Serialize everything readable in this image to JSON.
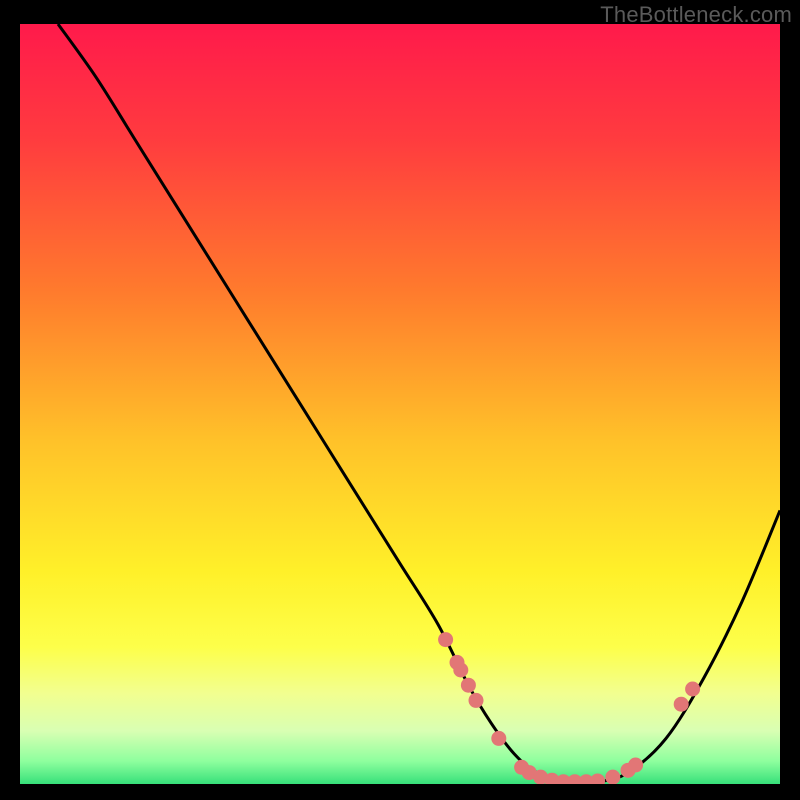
{
  "watermark": "TheBottleneck.com",
  "chart_data": {
    "type": "line",
    "title": "",
    "xlabel": "",
    "ylabel": "",
    "xlim": [
      0,
      100
    ],
    "ylim": [
      0,
      100
    ],
    "series": [
      {
        "name": "bottleneck-curve",
        "x": [
          5,
          10,
          15,
          20,
          25,
          30,
          35,
          40,
          45,
          50,
          55,
          59,
          62,
          65,
          68,
          72,
          76,
          80,
          85,
          90,
          95,
          100
        ],
        "y": [
          100,
          93,
          85,
          77,
          69,
          61,
          53,
          45,
          37,
          29,
          21,
          13,
          8,
          4,
          1.5,
          0.3,
          0.3,
          1.5,
          6,
          14,
          24,
          36
        ]
      }
    ],
    "markers": {
      "name": "highlighted-points",
      "color": "#e27676",
      "x": [
        56,
        57.5,
        58,
        59,
        60,
        63,
        66,
        67,
        68.5,
        70,
        71.5,
        73,
        74.5,
        76,
        78,
        80,
        81,
        87,
        88.5
      ],
      "y": [
        19,
        16,
        15,
        13,
        11,
        6,
        2.2,
        1.5,
        0.9,
        0.5,
        0.3,
        0.3,
        0.3,
        0.4,
        0.9,
        1.8,
        2.5,
        10.5,
        12.5
      ]
    },
    "background_gradient": {
      "stops": [
        {
          "offset": 0.0,
          "color": "#ff1a4b"
        },
        {
          "offset": 0.15,
          "color": "#ff3b3f"
        },
        {
          "offset": 0.35,
          "color": "#ff7a2d"
        },
        {
          "offset": 0.55,
          "color": "#ffc229"
        },
        {
          "offset": 0.72,
          "color": "#fff029"
        },
        {
          "offset": 0.82,
          "color": "#fdff4a"
        },
        {
          "offset": 0.88,
          "color": "#f2ff8f"
        },
        {
          "offset": 0.93,
          "color": "#d9ffb3"
        },
        {
          "offset": 0.97,
          "color": "#8eff9e"
        },
        {
          "offset": 1.0,
          "color": "#37e07a"
        }
      ]
    }
  }
}
